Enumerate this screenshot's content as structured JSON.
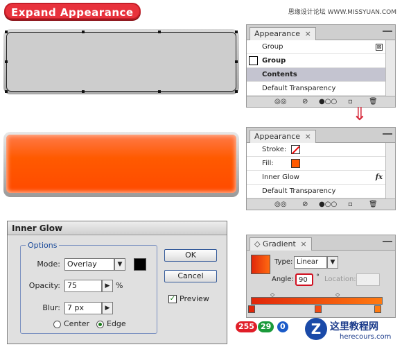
{
  "header": {
    "title": "Expand Appearance",
    "watermark": "思缘设计论坛 WWW.MISSYUAN.COM"
  },
  "appearance1": {
    "tab": "Appearance",
    "close": "×",
    "rows": [
      "Group",
      "Group",
      "Contents",
      "Default Transparency"
    ]
  },
  "appearance2": {
    "tab": "Appearance",
    "close": "×",
    "stroke": "Stroke:",
    "fill": "Fill:",
    "inner_glow": "Inner Glow",
    "fx": "fx",
    "default_transparency": "Default Transparency"
  },
  "dialog": {
    "title": "Inner Glow",
    "options": "Options",
    "mode_label": "Mode:",
    "mode_value": "Overlay",
    "opacity_label": "Opacity:",
    "opacity_value": "75",
    "percent": "%",
    "blur_label": "Blur:",
    "blur_value": "7 px",
    "center": "Center",
    "edge": "Edge",
    "ok": "OK",
    "cancel": "Cancel",
    "preview": "Preview",
    "preview_check": "✓",
    "spin_glyph": "▶",
    "dropdown_glyph": "▼"
  },
  "gradient": {
    "tab": "Gradient",
    "tab_icon": "◇",
    "close": "×",
    "type_label": "Type:",
    "type_value": "Linear",
    "angle_label": "Angle:",
    "angle_value": "90",
    "degree": "°",
    "location_label": "Location:"
  },
  "rgb": {
    "r": "255",
    "g": "29",
    "b": "0"
  },
  "logo": {
    "name": "这里教程网",
    "url": "herecours.com"
  },
  "colors": {
    "accent": "#ff5a00",
    "title_red": "#e8323c",
    "highlight": "#c4c4d0"
  }
}
